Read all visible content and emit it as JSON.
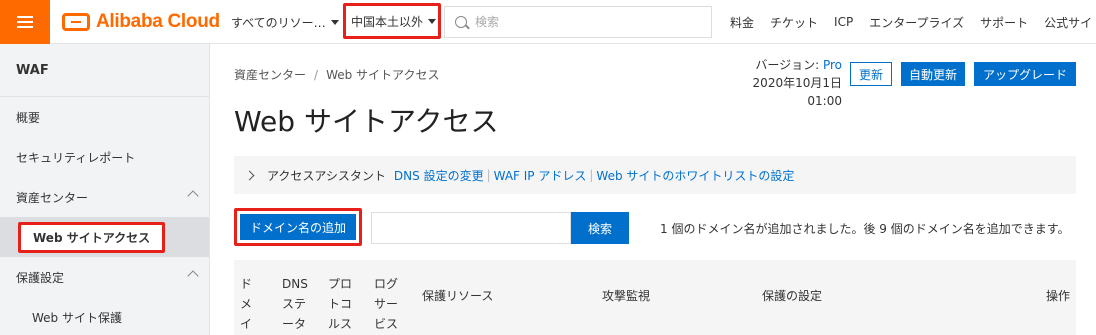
{
  "topbar": {
    "logo_text": "Alibaba Cloud",
    "resource_select": "すべてのリソー…",
    "region_select": "中国本土以外",
    "search_placeholder": "検索",
    "links": [
      "料金",
      "チケット",
      "ICP",
      "エンタープライズ",
      "サポート",
      "公式サイト"
    ]
  },
  "sidebar": {
    "title": "WAF",
    "items": [
      {
        "label": "概要"
      },
      {
        "label": "セキュリティレポート"
      },
      {
        "label": "資産センター"
      },
      {
        "label": "Web サイトアクセス"
      },
      {
        "label": "保護設定"
      },
      {
        "label": "Web サイト保護"
      }
    ]
  },
  "main": {
    "breadcrumb": [
      "資産センター",
      "Web サイトアクセス"
    ],
    "breadcrumb_sep": "/",
    "version_label": "バージョン:",
    "version_value": "Pro",
    "version_date": "2020年10月1日 01:00",
    "buttons": {
      "update": "更新",
      "auto_update": "自動更新",
      "upgrade": "アップグレード"
    },
    "title": "Web サイトアクセス",
    "assistant": {
      "label": "アクセスアシスタント",
      "links": [
        "DNS 設定の変更",
        "WAF IP アドレス",
        "Web サイトのホワイトリストの設定"
      ],
      "separator": "|"
    },
    "add_domain_label": "ドメイン名の追加",
    "search_button": "検索",
    "domain_count_text": "1 個のドメイン名が追加されました。後 9 個のドメイン名を追加できます。",
    "table_headers": [
      "ドメイン名",
      "DNS ステータス",
      "プロトコルステータス",
      "ログサービス",
      "保護リソース",
      "攻撃監視",
      "保護の設定",
      "操作"
    ]
  },
  "colors": {
    "brand": "#ff6a00",
    "primary": "#0070cc",
    "highlight": "#e8201a"
  }
}
